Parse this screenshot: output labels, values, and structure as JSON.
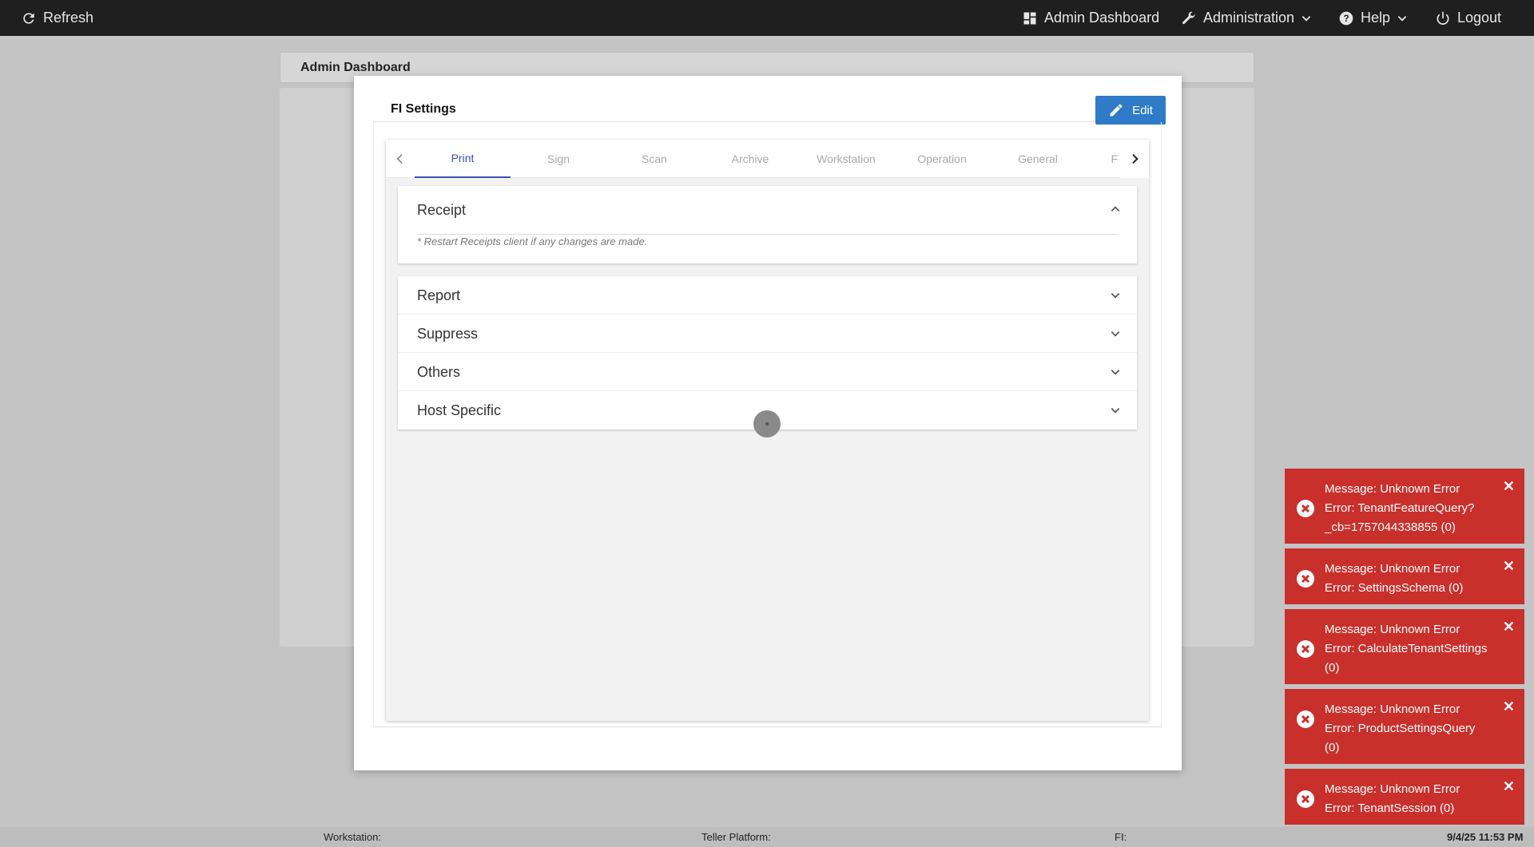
{
  "topbar": {
    "refresh": "Refresh",
    "admin_dashboard": "Admin Dashboard",
    "administration": "Administration",
    "help": "Help",
    "logout": "Logout"
  },
  "background": {
    "page_title": "Admin Dashboard"
  },
  "modal": {
    "title": "FI Settings",
    "edit_label": "Edit",
    "tabs": [
      "Print",
      "Sign",
      "Scan",
      "Archive",
      "Workstation",
      "Operation",
      "General",
      "F"
    ],
    "active_tab": "Print",
    "receipt": {
      "label": "Receipt",
      "note": "* Restart Receipts client if any changes are made."
    },
    "sections": [
      "Report",
      "Suppress",
      "Others",
      "Host Specific"
    ]
  },
  "toasts": [
    {
      "lines": [
        "Message: Unknown Error",
        "Error: TenantFeatureQuery?",
        "_cb=1757044338855 (0)"
      ]
    },
    {
      "lines": [
        "Message: Unknown Error",
        "Error: SettingsSchema (0)"
      ]
    },
    {
      "lines": [
        "Message: Unknown Error",
        "Error: CalculateTenantSettings",
        "(0)"
      ]
    },
    {
      "lines": [
        "Message: Unknown Error",
        "Error: ProductSettingsQuery (0)"
      ]
    },
    {
      "lines": [
        "Message: Unknown Error",
        "Error: TenantSession (0)"
      ]
    }
  ],
  "footer": {
    "workstation": "Workstation:",
    "teller_platform": "Teller Platform:",
    "fi": "FI:",
    "datetime": "9/4/25 11:53 PM"
  },
  "colors": {
    "accent": "#2f7bc8",
    "active_tab": "#3a4fb3",
    "error": "#c9302c"
  }
}
